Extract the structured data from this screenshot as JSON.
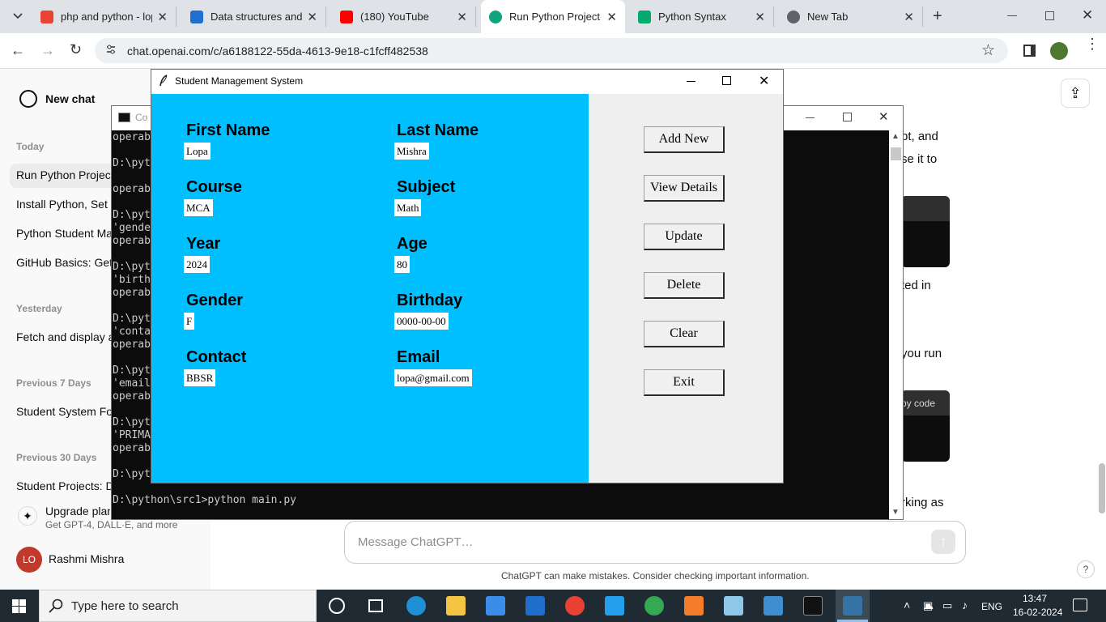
{
  "browser": {
    "tabs": [
      {
        "title": "php and python - lop",
        "color": "#ea4335"
      },
      {
        "title": "Data structures and A",
        "color": "#1f6fd1"
      },
      {
        "title": "(180) YouTube",
        "color": "#ff0000"
      },
      {
        "title": "Run Python Project S",
        "color": "#10a37f"
      },
      {
        "title": "Python Syntax",
        "color": "#04aa6d"
      },
      {
        "title": "New Tab",
        "color": "#5f6368"
      }
    ],
    "url": "chat.openai.com/c/a6188122-55da-4613-9e18-c1fcff482538"
  },
  "chatgpt": {
    "new_chat": "New chat",
    "sections": [
      {
        "heading": "Today",
        "items": [
          "Run Python Project",
          "Install Python, Set F",
          "Python Student Ma",
          "GitHub Basics: Get"
        ]
      },
      {
        "heading": "Yesterday",
        "items": [
          "Fetch and display a"
        ]
      },
      {
        "heading": "Previous 7 Days",
        "items": [
          "Student System Fo"
        ]
      },
      {
        "heading": "Previous 30 Days",
        "items": [
          "Student Projects: D"
        ]
      }
    ],
    "upgrade_title": "Upgrade plan",
    "upgrade_sub": "Get GPT-4, DALL·E, and more",
    "user_initials": "LO",
    "user_name": "Rashmi Mishra",
    "chat_fragments": [
      "pt, and",
      "se it to",
      "ted in",
      "you run",
      "py code",
      "rking as"
    ],
    "message_placeholder": "Message ChatGPT…",
    "disclaimer": "ChatGPT can make mistakes. Consider checking important information.",
    "help": "?"
  },
  "console": {
    "title": "Co",
    "lines": [
      "operab",
      "",
      "D:\\pyt 'age'",
      "operab",
      "",
      "D:\\pyt",
      "'gende",
      "operab",
      "",
      "D:\\pyt",
      "'birth",
      "operab",
      "",
      "D:\\pyt",
      "'conta",
      "operab",
      "",
      "D:\\pyt",
      "'email",
      "operab",
      "",
      "D:\\pyt",
      "'PRIMA",
      "operab",
      "",
      "D:\\pyt",
      "",
      "D:\\python\\src1>python main.py"
    ]
  },
  "app": {
    "title": "Student Management System",
    "fields": [
      {
        "label": "First Name",
        "value": "Lopa"
      },
      {
        "label": "Last Name",
        "value": "Mishra"
      },
      {
        "label": "Course",
        "value": "MCA"
      },
      {
        "label": "Subject",
        "value": "Math"
      },
      {
        "label": "Year",
        "value": "2024"
      },
      {
        "label": "Age",
        "value": "80"
      },
      {
        "label": "Gender",
        "value": "F"
      },
      {
        "label": "Birthday",
        "value": "0000-00-00"
      },
      {
        "label": "Contact",
        "value": "BBSR"
      },
      {
        "label": "Email",
        "value": "lopa@gmail.com"
      }
    ],
    "buttons": [
      "Add New",
      "View Details",
      "Update",
      "Delete",
      "Clear",
      "Exit"
    ],
    "panel_color": "#00bfff"
  },
  "taskbar": {
    "search_placeholder": "Type here to search",
    "language": "ENG",
    "time": "13:47",
    "date": "16-02-2024"
  }
}
